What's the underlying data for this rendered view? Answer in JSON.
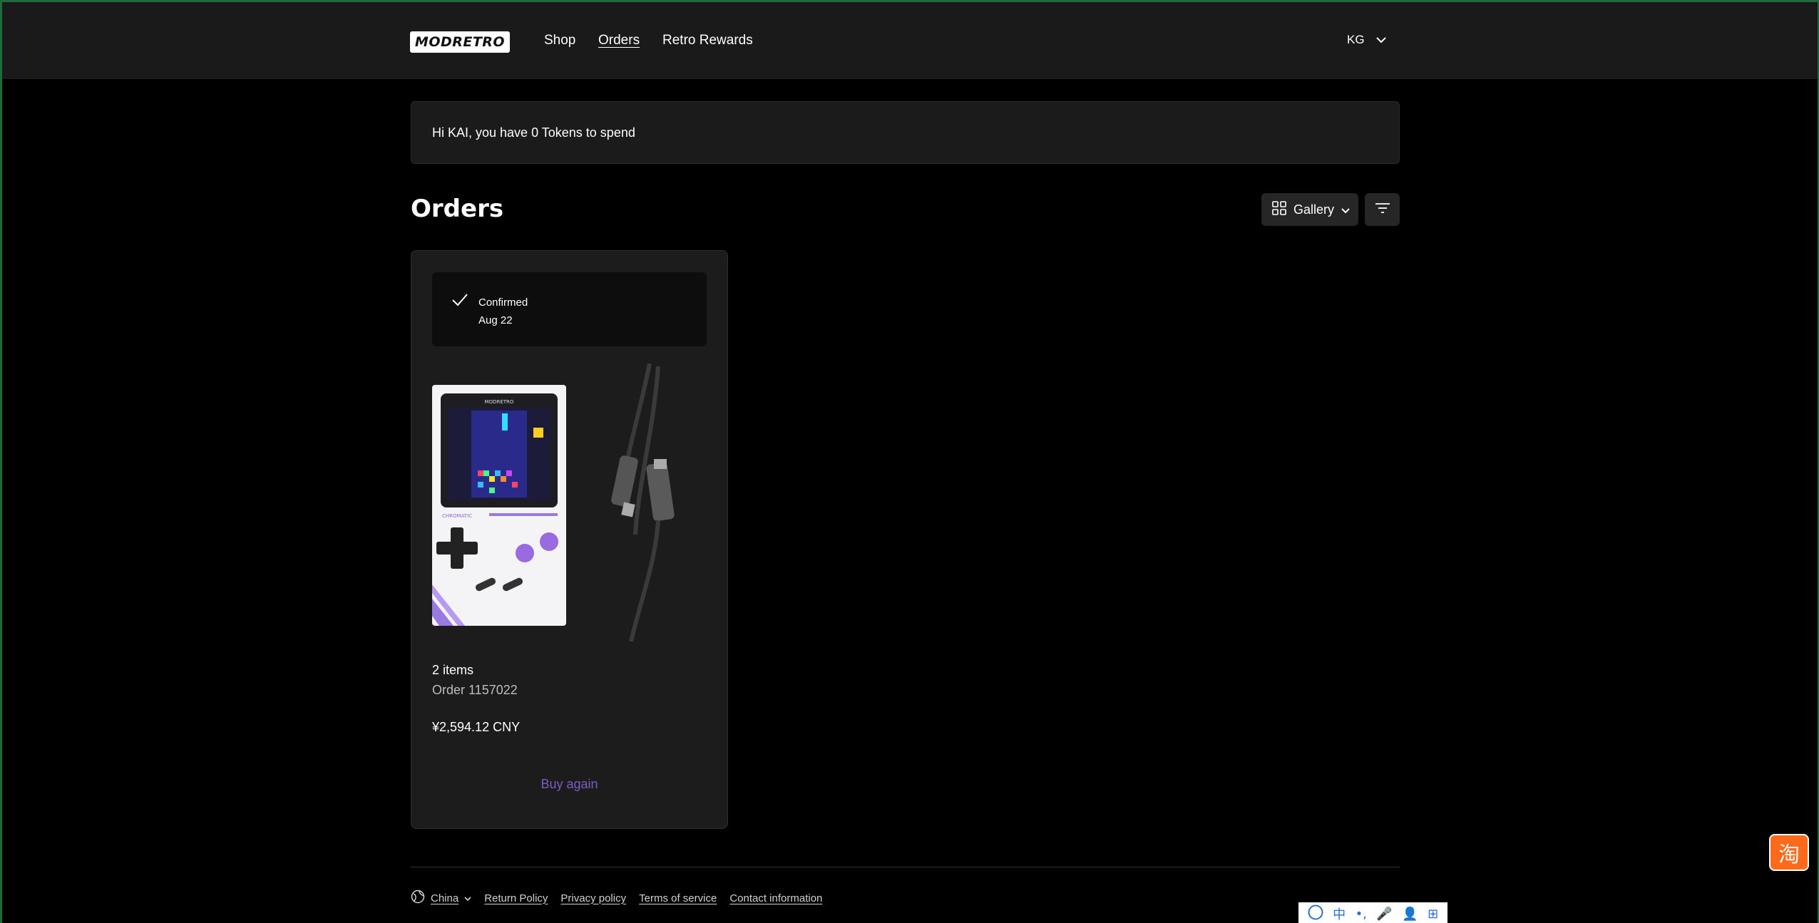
{
  "header": {
    "logo": "MODRETRO",
    "nav": [
      {
        "label": "Shop"
      },
      {
        "label": "Orders"
      },
      {
        "label": "Retro Rewards"
      }
    ],
    "account_initials": "KG"
  },
  "tokens_banner": "Hi KAI, you have 0 Tokens to spend",
  "page": {
    "title": "Orders",
    "view_label": "Gallery"
  },
  "order": {
    "status": "Confirmed",
    "date": "Aug 22",
    "items_count": "2 items",
    "order_number": "Order 1157022",
    "total": "¥2,594.12 CNY",
    "buy_again": "Buy again",
    "console_logo": "MODRETRO",
    "console_label": "CHROMATIC"
  },
  "footer": {
    "country": "China",
    "links": [
      "Return Policy",
      "Privacy policy",
      "Terms of service",
      "Contact information"
    ]
  },
  "overlays": {
    "taobao_glyph": "淘",
    "ime_items": [
      "中",
      "•,",
      "🎤",
      "👤",
      "⊞"
    ]
  },
  "colors": {
    "background": "#000000",
    "header_bg": "#1a1a1a",
    "card_bg": "#1c1c1c",
    "accent_purple": "#7c5cc4",
    "taobao_orange": "#ff6a1a"
  }
}
